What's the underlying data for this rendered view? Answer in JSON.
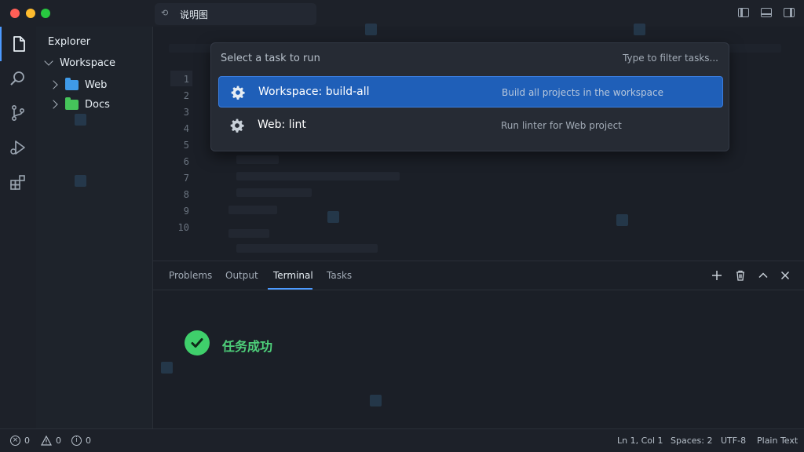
{
  "titlebar": {
    "search_text": "说明图"
  },
  "sidebar": {
    "title": "Explorer",
    "root": "Workspace",
    "folders": [
      {
        "label": "Web",
        "color": "#3f9ae8"
      },
      {
        "label": "Docs",
        "color": "#45c45a"
      }
    ]
  },
  "editor": {
    "line_numbers": [
      "1",
      "2",
      "3",
      "4",
      "5",
      "6",
      "7",
      "8",
      "9",
      "10"
    ]
  },
  "palette": {
    "prompt": "Select a task to run",
    "hint": "Type to filter tasks...",
    "items": [
      {
        "name": "Workspace: build-all",
        "desc": "Build all projects in the workspace",
        "selected": true
      },
      {
        "name": "Web: lint",
        "desc": "Run linter for Web project",
        "selected": false
      }
    ]
  },
  "panel": {
    "tabs": [
      "Problems",
      "Output",
      "Terminal",
      "Tasks"
    ],
    "active_tab": "Terminal",
    "status_text": "任务成功"
  },
  "statusbar": {
    "errors": "0",
    "warnings": "0",
    "infos": "0",
    "position": "Ln 1, Col 1",
    "spaces": "Spaces: 2",
    "encoding": "UTF-8",
    "language": "Plain Text"
  },
  "colors": {
    "accent": "#4c9aff",
    "selection": "#1f5fb8",
    "success": "#3fcf6b"
  }
}
